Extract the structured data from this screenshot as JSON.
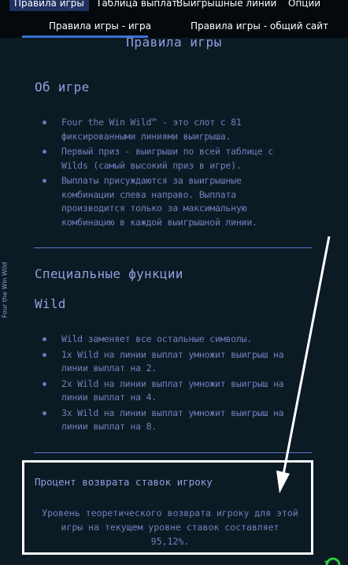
{
  "top_tabs": [
    {
      "label": "Правила игры",
      "active": true
    },
    {
      "label": "Таблица выплат",
      "active": false
    },
    {
      "label": "Выигрышные линии",
      "active": false
    },
    {
      "label": "Опции",
      "active": false
    }
  ],
  "sub_tabs": [
    {
      "label": "Правила игры - игра",
      "active": true
    },
    {
      "label": "Правила игры - общий сайт",
      "active": false
    }
  ],
  "side_label": "Four the Win Wild",
  "page_title": "Правила игры",
  "about": {
    "heading": "Об игре",
    "bullets": [
      "Four the Win Wild™ - это слот с 81 фиксированными линиями выигрыша.",
      "Первый приз - выигрыши по всей таблице с Wilds (самый высокий приз в игре).",
      "Выплаты присуждаются за выигрышные комбинации слева направо. Выплата производится только за максимальную комбинацию в каждой выигрышной линии."
    ]
  },
  "special": {
    "heading": "Специальные функции",
    "subheading": "Wild",
    "bullets": [
      "Wild заменяет все остальные символы.",
      "1x Wild на линии выплат умножит выигрыш на линии выплат на 2.",
      "2x Wild на линии выплат умножит выигрыш на линии выплат на 4.",
      "3x Wild на линии выплат умножит выигрыш на линии выплат на 8."
    ]
  },
  "rtp": {
    "heading": "Процент возврата ставок игроку",
    "text": "Уровень теоретического возврата игроку для этой игры на текущем уровне ставок составляет 95,12%."
  },
  "colors": {
    "background": "#0c1a24",
    "text": "#8a9ad8",
    "accent": "#3a72d4",
    "highlight_box": "#ffffff",
    "corner_icon": "#2ecc40"
  },
  "icons": {
    "corner": "refresh-arrow-icon"
  }
}
